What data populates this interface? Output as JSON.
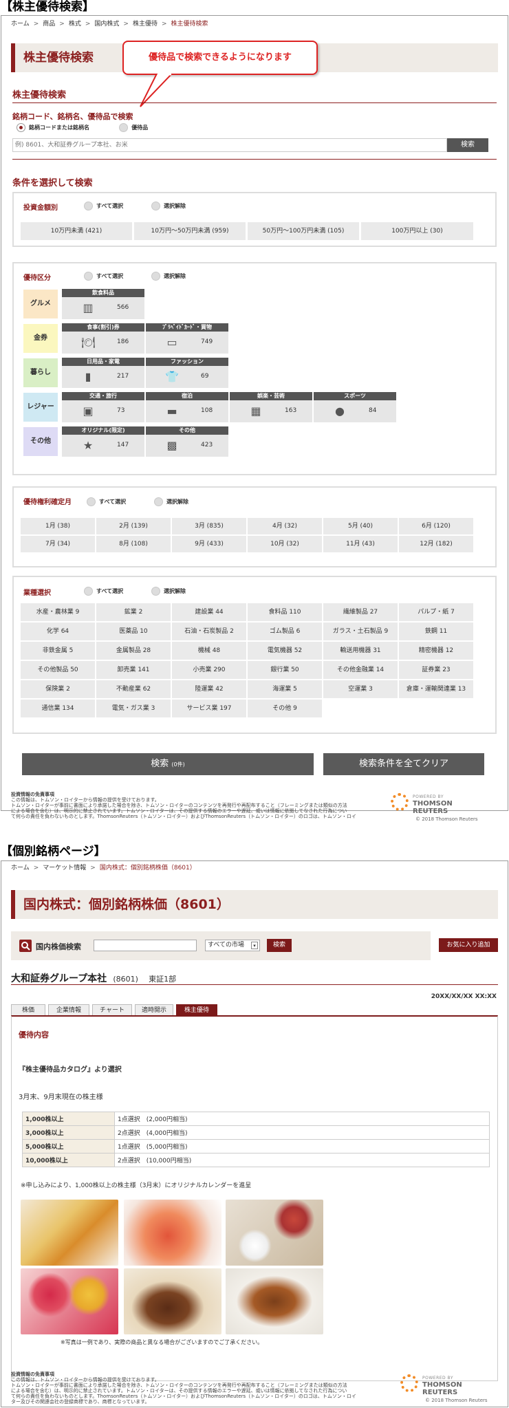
{
  "section1_label": "【株主優待検索】",
  "section2_label": "【個別銘柄ページ】",
  "breadcrumb1": {
    "home": "ホーム",
    "items": [
      "商品",
      "株式",
      "国内株式",
      "株主優待"
    ],
    "current": "株主優待検索",
    "sep": ">"
  },
  "page_title1": "株主優待検索",
  "callout": "優待品で検索できるようになります",
  "search_heading": "株主優待検索",
  "search_subheading": "銘柄コード、銘柄名、優待品で検索",
  "radio_code": "銘柄コードまたは銘柄名",
  "radio_gift": "優待品",
  "search_placeholder": "例) 8601、大和証券グループ本社、お米",
  "search_button": "検索",
  "cond_heading": "条件を選択して検索",
  "select_all": "すべて選択",
  "deselect": "選択解除",
  "invest": {
    "title": "投資金額別",
    "cells": [
      "10万円未満 (421)",
      "10万円〜50万円未満 (959)",
      "50万円〜100万円未満 (105)",
      "100万円以上 (30)"
    ]
  },
  "yutai": {
    "title": "優待区分",
    "categories": [
      {
        "name": "グルメ",
        "color": "#fbe7c6",
        "items": [
          {
            "label": "飲食料品",
            "count": "566",
            "icon": "food-icon"
          }
        ]
      },
      {
        "name": "金券",
        "color": "#fbf7bf",
        "items": [
          {
            "label": "食事(割引)券",
            "count": "186",
            "icon": "meal-icon"
          },
          {
            "label": "ﾌﾟﾘﾍﾟｲﾄﾞｶｰﾄﾞ・買物",
            "count": "749",
            "icon": "card-icon"
          }
        ]
      },
      {
        "name": "暮らし",
        "color": "#d9efc5",
        "items": [
          {
            "label": "日用品・家電",
            "count": "217",
            "icon": "daily-icon"
          },
          {
            "label": "ファッション",
            "count": "69",
            "icon": "shirt-icon"
          }
        ]
      },
      {
        "name": "レジャー",
        "color": "#cfe9f3",
        "items": [
          {
            "label": "交通・旅行",
            "count": "73",
            "icon": "luggage-icon"
          },
          {
            "label": "宿泊",
            "count": "108",
            "icon": "bed-icon"
          },
          {
            "label": "娯楽・芸術",
            "count": "163",
            "icon": "film-icon"
          },
          {
            "label": "スポーツ",
            "count": "84",
            "icon": "ball-icon"
          }
        ]
      },
      {
        "name": "その他",
        "color": "#dedbf5",
        "items": [
          {
            "label": "オリジナル(限定)",
            "count": "147",
            "icon": "star-icon"
          },
          {
            "label": "その他",
            "count": "423",
            "icon": "gift-icon"
          }
        ]
      }
    ]
  },
  "month": {
    "title": "優待権利確定月",
    "cells": [
      "1月 (38)",
      "2月 (139)",
      "3月 (835)",
      "4月 (32)",
      "5月 (40)",
      "6月 (120)",
      "7月 (34)",
      "8月 (108)",
      "9月 (433)",
      "10月 (32)",
      "11月 (43)",
      "12月 (182)"
    ]
  },
  "industry": {
    "title": "業種選択",
    "cells": [
      "水産・農林業 9",
      "鉱業 2",
      "建設業 44",
      "食料品 110",
      "繊維製品 27",
      "パルプ・紙 7",
      "化学 64",
      "医薬品 10",
      "石油・石炭製品 2",
      "ゴム製品 6",
      "ガラス・土石製品 9",
      "鉄鋼 11",
      "非鉄金属 5",
      "金属製品 28",
      "機械 48",
      "電気機器 52",
      "輸送用機器 31",
      "精密機器 12",
      "その他製品 50",
      "卸売業 141",
      "小売業 290",
      "銀行業 50",
      "その他金融業 14",
      "証券業 23",
      "保険業 2",
      "不動産業 62",
      "陸運業 42",
      "海運業 5",
      "空運業 3",
      "倉庫・運輸関連業 13",
      "通信業 134",
      "電気・ガス業 3",
      "サービス業 197",
      "その他 9"
    ]
  },
  "btn_search": "検索",
  "btn_search_count": "(0件)",
  "btn_clear": "検索条件を全てクリア",
  "disclaimer_title": "投資情報の免責事項",
  "disclaimer_lines": [
    "この情報は、トムソン・ロイターから情報の提供を受けております。",
    "トムソン・ロイターが事前に書面により承諾した場合を除き、トムソン・ロイターのコンテンツを再発行や再配布すること（フレーミングまたは類似の方法",
    "による場合を含む）は、明示的に禁止されています。トムソン・ロイターは、その提供する情報のエラーや遅延、或いは情報に依拠してなされた行為につい",
    "て何らの責任を負わないものとします。ThomsonReuters（トムソン・ロイター）およびThomsonReuters（トムソン・ロイター）のロゴは、トムソン・ロイ",
    "ター及びその関連会社の登録商標であり、商標となっています。"
  ],
  "tr_powered": "POWERED BY",
  "tr_name": "THOMSON REUTERS",
  "tr_copy": "© 2018 Thomson Reuters",
  "breadcrumb2": {
    "home": "ホーム",
    "items": [
      "マーケット情報"
    ],
    "current": "国内株式：個別銘柄株価（8601）"
  },
  "page_title2": "国内株式：個別銘柄株価（8601）",
  "stock_search_label": "国内株価検索",
  "market_select": "すべての市場",
  "stock_search_btn": "検索",
  "fav_btn": "お気に入り追加",
  "company_name": "大和証券グループ本社",
  "company_code": "(8601)",
  "company_market": "東証1部",
  "datetime": "20XX/XX/XX XX:XX",
  "tabs": [
    "株価",
    "企業情報",
    "チャート",
    "適時開示",
    "株主優待"
  ],
  "yutai_heading": "優待内容",
  "catalog_line": "『株主優待品カタログ』より選択",
  "holder_line": "3月末、9月末現在の株主様",
  "benefit_rows": [
    {
      "k": "1,000株以上",
      "v": "1点選択　(2,000円相当)"
    },
    {
      "k": "3,000株以上",
      "v": "2点選択　(4,000円相当)"
    },
    {
      "k": "5,000株以上",
      "v": "1点選択　(5,000円相当)"
    },
    {
      "k": "10,000株以上",
      "v": "2点選択　(10,000円相当)"
    }
  ],
  "note_line": "※申し込みにより、1,000株以上の株主様（3月末）にオリジナルカレンダーを進呈",
  "photo_note": "※写真は一例であり、実際の商品と異なる場合がございますのでご了承ください。",
  "accent": "#8c1f1f"
}
